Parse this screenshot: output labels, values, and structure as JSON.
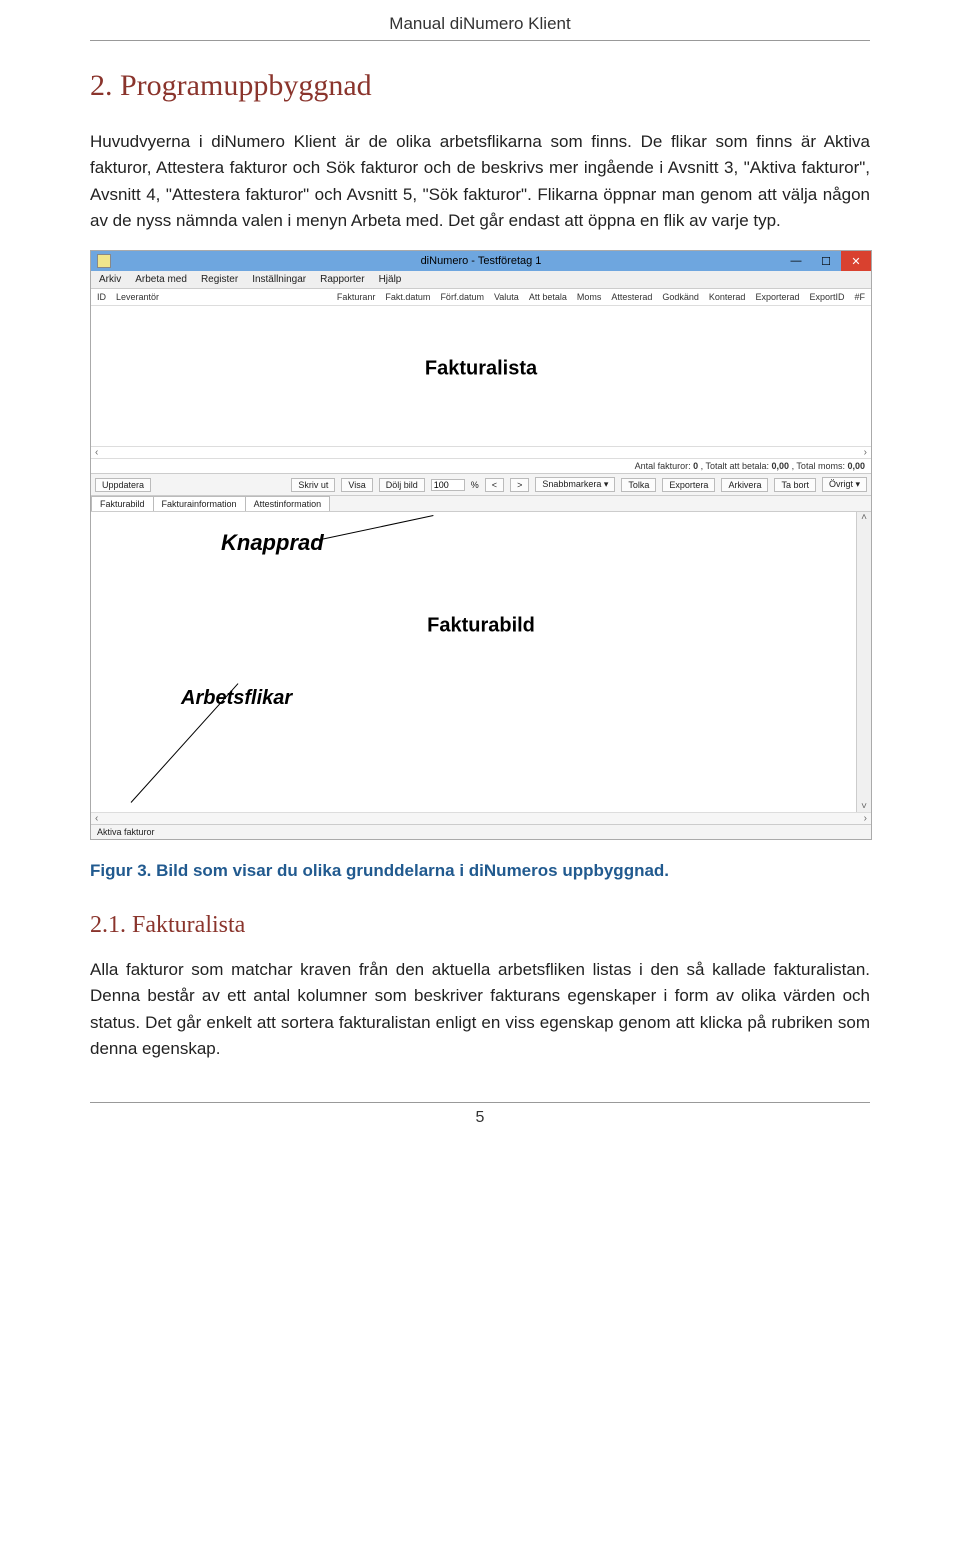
{
  "running_header": "Manual diNumero Klient",
  "page_number": "5",
  "section": {
    "title": "2. Programuppbyggnad",
    "p1": "Huvudvyerna i diNumero Klient är de olika arbetsflikarna som finns. De flikar som finns är Aktiva fakturor, Attestera fakturor och Sök fakturor och de beskrivs mer ingående i Avsnitt 3, \"Aktiva fakturor\", Avsnitt 4, \"Attestera fakturor\" och Avsnitt 5, \"Sök fakturor\". Flikarna öppnar man genom att välja någon av de nyss nämnda valen i menyn Arbeta med. Det går endast att öppna en flik av varje typ."
  },
  "figure_caption": "Figur 3. Bild som visar du olika grunddelarna i diNumeros uppbyggnad.",
  "subsection": {
    "title": "2.1. Fakturalista",
    "p1": "Alla fakturor som matchar kraven från den aktuella arbetsfliken listas i den så kallade fakturalistan. Denna består av ett antal kolumner som beskriver fakturans egenskaper i form av olika värden och status. Det går enkelt att sortera fakturalistan enligt en viss egenskap genom att klicka på rubriken som denna egenskap."
  },
  "app": {
    "title": "diNumero - Testföretag 1",
    "menu": [
      "Arkiv",
      "Arbeta med",
      "Register",
      "Inställningar",
      "Rapporter",
      "Hjälp"
    ],
    "columns": [
      "ID",
      "Leverantör",
      "Fakturanr",
      "Fakt.datum",
      "Förf.datum",
      "Valuta",
      "Att betala",
      "Moms",
      "Attesterad",
      "Godkänd",
      "Konterad",
      "Exporterad",
      "ExportID",
      "#F"
    ],
    "annotations": {
      "fakturalista": "Fakturalista",
      "knapprad": "Knapprad",
      "fakturabild": "Fakturabild",
      "arbetsflikar": "Arbetsflikar"
    },
    "status": {
      "antal_l": "Antal fakturor:",
      "antal_v": "0",
      "totalt_l": ", Totalt att betala:",
      "totalt_v": "0,00",
      "moms_l": ", Total moms:",
      "moms_v": "0,00"
    },
    "toolbar": {
      "uppdatera": "Uppdatera",
      "skrivut": "Skriv ut",
      "visa": "Visa",
      "doljbild": "Dölj bild",
      "zoom": "100",
      "pct": "%",
      "lt": "<",
      "gt": ">",
      "snabb": "Snabbmarkera ▾",
      "tolka": "Tolka",
      "exportera": "Exportera",
      "arkivera": "Arkivera",
      "tabort": "Ta bort",
      "ovrigt": "Övrigt ▾"
    },
    "tabs": [
      "Fakturabild",
      "Fakturainformation",
      "Attestinformation"
    ],
    "footer_tab": "Aktiva fakturor"
  }
}
